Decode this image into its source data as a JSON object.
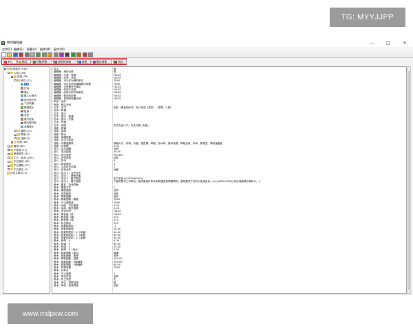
{
  "watermarks": {
    "tag": "TG: MYYJJPP",
    "site": "www.mdpxw.com"
  },
  "window": {
    "title": "物体编辑器",
    "controls": [
      "—",
      "□",
      "✕"
    ]
  },
  "menu": [
    "文件(F)",
    "编辑(E)",
    "察看(V)",
    "插件(M)",
    "窗口(W)"
  ],
  "toolbar": {
    "icons": [
      "new-icon",
      "open-icon",
      "save-icon",
      "cut-icon",
      "copy-icon",
      "paste-icon",
      "undo-icon",
      "terrain-icon",
      "trigger-icon",
      "sound-icon",
      "object-icon",
      "camera-icon",
      "ai-icon",
      "region-icon",
      "unit-icon",
      "item-icon"
    ]
  },
  "tabs": [
    {
      "label": "单位",
      "color": "#c43"
    },
    {
      "label": "物品",
      "color": "#d8a030"
    },
    {
      "label": "可破坏物",
      "color": "#4a8a3a"
    },
    {
      "label": "地形装饰物",
      "color": "#6a6a6a"
    },
    {
      "label": "技能",
      "color": "#3a5ec0"
    },
    {
      "label": "魔法效果",
      "color": "#a33ab0"
    },
    {
      "label": "科技",
      "color": "#7a5a2a"
    }
  ],
  "tree": [
    {
      "label": "标准单位 (934)",
      "depth": 0,
      "expander": "-",
      "icon": "folder"
    },
    {
      "label": "人族 (156)",
      "depth": 1,
      "expander": "-",
      "icon": "folder"
    },
    {
      "label": "战役 (36)",
      "depth": 2,
      "expander": "-",
      "icon": "folder"
    },
    {
      "label": "单位 (22)",
      "depth": 3,
      "expander": "-",
      "icon": "folder"
    },
    {
      "label": "农民",
      "depth": 4,
      "expander": "",
      "icon": "unit",
      "selected": true
    },
    {
      "label": "步兵",
      "depth": 4,
      "expander": "",
      "icon": "unit"
    },
    {
      "label": "骑士",
      "depth": 4,
      "expander": "",
      "icon": "unit"
    },
    {
      "label": "矮人火枪手",
      "depth": 4,
      "expander": "",
      "icon": "unit"
    },
    {
      "label": "迫击炮小队",
      "depth": 4,
      "expander": "",
      "icon": "unit"
    },
    {
      "label": "飞行机器",
      "depth": 4,
      "expander": "",
      "icon": "unit"
    },
    {
      "label": "狮鹫骑士",
      "depth": 4,
      "expander": "",
      "icon": "unit"
    },
    {
      "label": "牧师",
      "depth": 4,
      "expander": "",
      "icon": "unit"
    },
    {
      "label": "女巫",
      "depth": 4,
      "expander": "",
      "icon": "unit"
    },
    {
      "label": "蒸汽坦克",
      "depth": 4,
      "expander": "",
      "icon": "unit"
    },
    {
      "label": "魔法破坏者",
      "depth": 4,
      "expander": "",
      "icon": "unit"
    },
    {
      "label": "龙鹰骑士",
      "depth": 4,
      "expander": "",
      "icon": "unit"
    },
    {
      "label": "建筑 (14)",
      "depth": 3,
      "expander": "+",
      "icon": "folder"
    },
    {
      "label": "英雄 (4)",
      "depth": 3,
      "expander": "+",
      "icon": "folder"
    },
    {
      "label": "特殊 (3)",
      "depth": 3,
      "expander": "+",
      "icon": "folder"
    },
    {
      "label": "战役 (80)",
      "depth": 2,
      "expander": "+",
      "icon": "folder"
    },
    {
      "label": "兽族 (86)",
      "depth": 1,
      "expander": "+",
      "icon": "folder"
    },
    {
      "label": "不死族 (77)",
      "depth": 1,
      "expander": "+",
      "icon": "folder"
    },
    {
      "label": "暗夜精灵 (83)",
      "depth": 1,
      "expander": "+",
      "icon": "folder"
    },
    {
      "label": "中立 - 敌对 (265)",
      "depth": 1,
      "expander": "+",
      "icon": "folder"
    },
    {
      "label": "中立被动 (48)",
      "depth": 1,
      "expander": "+",
      "icon": "folder"
    },
    {
      "label": "中立建筑 (73)",
      "depth": 1,
      "expander": "+",
      "icon": "folder"
    },
    {
      "label": "中立单位 (7)",
      "depth": 1,
      "expander": "+",
      "icon": "folder"
    },
    {
      "label": "自定义单位 (0)",
      "depth": 0,
      "expander": "",
      "icon": "folder"
    }
  ],
  "properties": [
    [
      "名字",
      "值"
    ],
    [
      "编辑器 - 地形分类",
      "哦"
    ],
    [
      "编辑器 - 分类 - 特殊",
      "FALSE"
    ],
    [
      "编辑器 - 分类 - 战役",
      "FALSE"
    ],
    [
      "编辑器 - 可以作为随机单位",
      "TRUE"
    ],
    [
      "编辑器 - 可以在地形编辑器中放置",
      "TRUE"
    ],
    [
      "编辑器 - 可放置在光谱区",
      "FALSE"
    ],
    [
      "编辑器 - 作用于战场",
      "FALSE"
    ],
    [
      "编辑器 - 战役中的平民单位",
      "FALSE"
    ],
    [
      "编辑器 - 使用低密度",
      "FALSE"
    ],
    [
      "编辑器 - 有效的地图区域",
      "FALSE"
    ],
    [
      "声音 - 地形",
      ""
    ],
    [
      "声音 - 默认步伐",
      ""
    ],
    [
      "文本 - 名字",
      "农民（黄金和木材，战斗号召（变形），修理（人族）"
    ],
    [
      "文本 - 称谓",
      ""
    ],
    [
      "文本 - 提示",
      ""
    ],
    [
      "文本 - 提示 - 普通",
      ""
    ],
    [
      "文本 - 提示 - 扩展",
      ""
    ],
    [
      "文本 - 热键",
      ""
    ],
    [
      "文本 - 说明",
      "农夫在战斗中。农夫可能 (升级)"
    ],
    [
      "技能 - 普通",
      ""
    ],
    [
      "技能 - 英雄",
      ""
    ],
    [
      "技能 - 默认",
      ""
    ],
    [
      "技能 - 英雄技能",
      ""
    ],
    [
      "技能 - 可学习技能",
      ""
    ],
    [
      "技能 - 可建造建筑",
      "城镇大厅，农场，兵营，铁匠铺，哨塔，伐木场，奥术圣殿，神秘圣地，车间，狮鹫笼，神秘宝藏室"
    ],
    [
      "技能 - 可修理",
      "0.00"
    ],
    [
      "战斗 - 攻击间隔",
      "没有"
    ],
    [
      "战斗 - 攻击距离",
      "16.00"
    ],
    [
      "战斗 - 攻击类型",
      "Percent"
    ],
    [
      "战斗 - 护甲类型",
      "轻型"
    ],
    [
      "战斗 - 护甲",
      "0"
    ],
    [
      "战斗 - 防御类型",
      "1"
    ],
    [
      "战斗 - 主动攻击范围",
      "0"
    ],
    [
      "战斗 - 目标允许",
      "地面"
    ],
    [
      "战斗 - 攻击 1 - 允许攻击",
      ""
    ],
    [
      "战斗 - 攻击 1 - 基础伤害",
      ""
    ],
    [
      "战斗 - 攻击 1 - 骰子数量",
      "生产农民1x1500x600x1x"
    ],
    [
      "战斗 - 攻击 1 - 骰子面数",
      "人族的基本工作单位，能采集金矿和木材和建造各种建筑物，紧急情况下还可以变成民兵。|n|n|cffffcc00可以攻击地面单位和树木。|r"
    ],
    [
      "美术 - 图标 - 游戏界面",
      ""
    ],
    [
      "美术 - 模型文件",
      "F"
    ],
    [
      "美术 - 模型缩放",
      "没有"
    ],
    [
      "美术 - 选择缩放",
      "没有"
    ],
    [
      "美术 - 阴影图像",
      "没有"
    ],
    [
      "美术 - 阴影图像 - 高度",
      "TRUE"
    ],
    [
      "美术 - 可以被建造",
      "TRUE"
    ],
    [
      "美术 - 动画 - 行走速度",
      "1.00"
    ],
    [
      "美术 - 动画 - 跑步速度",
      "1.00"
    ],
    [
      "美术 - 混合时间",
      "FALSE"
    ],
    [
      "美术 - 颜色值（红）",
      "FALSE"
    ],
    [
      "美术 - 颜色值（绿）",
      "255"
    ],
    [
      "美术 - 颜色值（蓝）",
      "255"
    ],
    [
      "美术 - 队伍颜色",
      "255"
    ],
    [
      "美术 - 投射物发射",
      "-1"
    ],
    [
      "美术 - 投射物碰撞",
      "10.00"
    ],
    [
      "美术 - 投射物发射 - X（深度）",
      "10.00"
    ],
    [
      "美术 - 投射物发射 - Y（深度）",
      "60.00"
    ],
    [
      "美术 - 投射物发射 - Z（深度）",
      "40.00"
    ],
    [
      "美术 - 射弹 - X",
      "0.00"
    ],
    [
      "美术 - 射弹 - Y",
      "40.00"
    ],
    [
      "美术 - 射弹 - Z",
      "20.00"
    ],
    [
      "美术 - 射弹 - Z（深水）",
      "0.00"
    ],
    [
      "美术 - 阴影图像（单位）",
      "普通"
    ],
    [
      "美术 - 阴影图像 - 宽度",
      "没有"
    ],
    [
      "美术 - 阴影图像 - 高度",
      "100.00"
    ],
    [
      "美术 - 阴影图像 - X轴偏移",
      "100.00"
    ],
    [
      "美术 - 阴影图像 - Y轴偏移",
      "60.00"
    ],
    [
      "美术 - 特殊效果",
      "TRUE"
    ],
    [
      "美术 - 目标点",
      ""
    ],
    [
      "美术 - 可以逃跑",
      "1"
    ],
    [
      "美术 - 单位声音",
      "没有"
    ],
    [
      "美术 - 死亡类型",
      "无"
    ],
    [
      "美术 - 单位 - 视野范围",
      "哦"
    ],
    [
      "美术 - 单位 - 游戏界面",
      "农民"
    ]
  ]
}
